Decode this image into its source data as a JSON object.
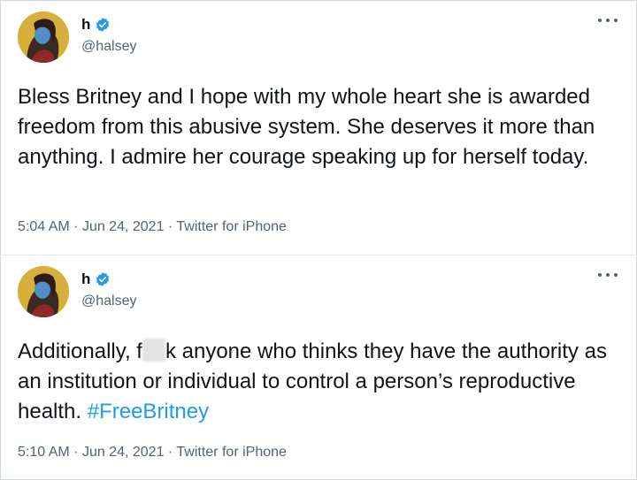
{
  "tweets": [
    {
      "display_name": "h",
      "handle": "@halsey",
      "text": "Bless Britney and I hope with my whole heart she is awarded freedom from this abusive system. She deserves it more than anything. I admire her courage speaking up for herself today.",
      "time": "5:04 AM",
      "date": "Jun 24, 2021",
      "source": "Twitter for iPhone",
      "sep": "·"
    },
    {
      "display_name": "h",
      "handle": "@halsey",
      "text_before": "Additionally, f",
      "text_after": "k anyone who thinks they have the authority as an institution or individual to control a person’s reproductive health. ",
      "hashtag": "#FreeBritney",
      "time": "5:10 AM",
      "date": "Jun 24, 2021",
      "source": "Twitter for iPhone",
      "sep": "·"
    }
  ],
  "colors": {
    "verified": "#1d9bf0",
    "hashtag": "#1d9bf0",
    "muted": "#536471"
  },
  "icons": [
    "verified-badge-icon",
    "more-options-icon"
  ]
}
